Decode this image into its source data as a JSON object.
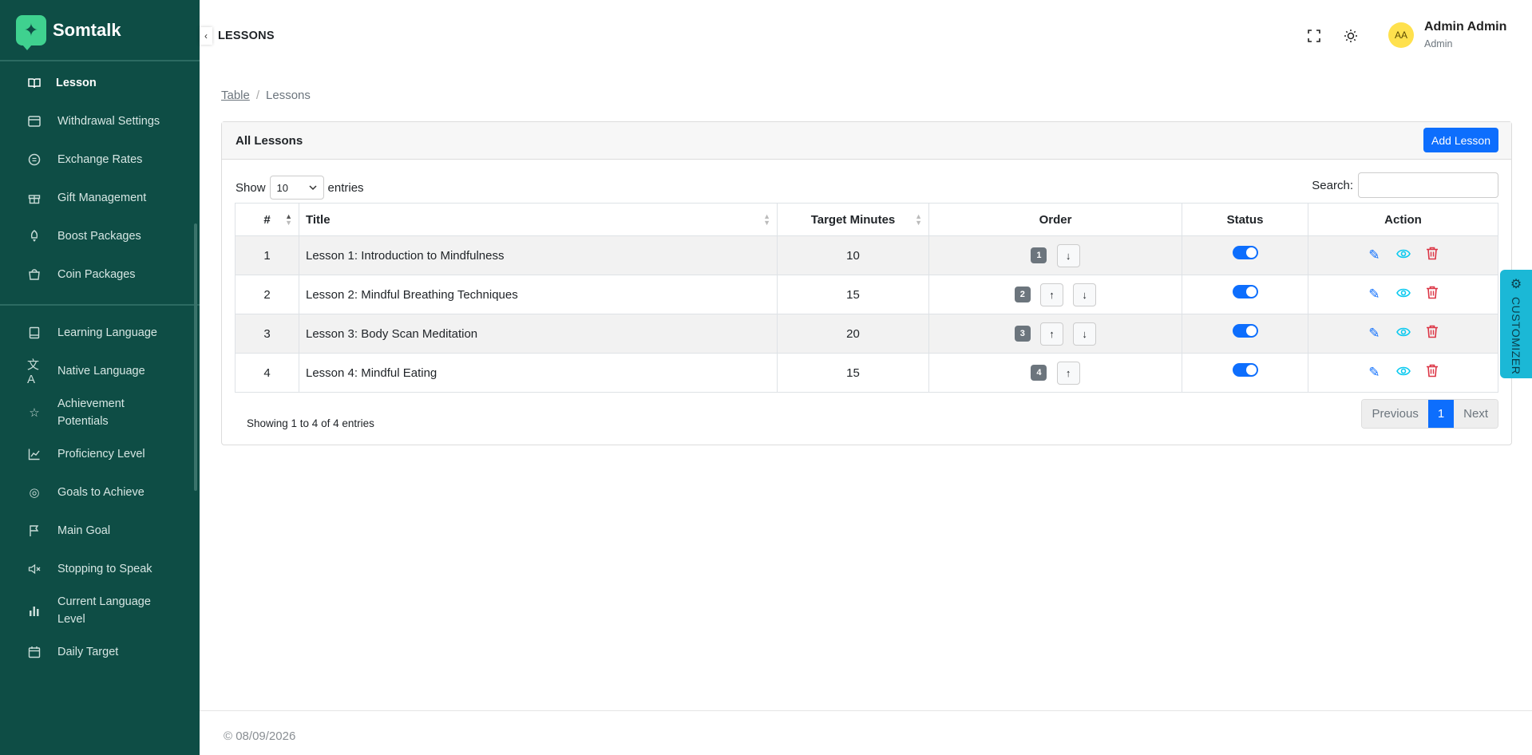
{
  "brand": {
    "name": "Somtalk",
    "logo_icon": "sparkle-icon",
    "sidebar_color": "#0e4d45"
  },
  "sidebar": {
    "group1": [
      {
        "label": "Lesson",
        "icon": "book-icon",
        "active": true
      },
      {
        "label": "Withdrawal Settings",
        "icon": "card-icon"
      },
      {
        "label": "Exchange Rates",
        "icon": "currency-icon"
      },
      {
        "label": "Gift Management",
        "icon": "gift-icon"
      },
      {
        "label": "Boost Packages",
        "icon": "rocket-icon"
      },
      {
        "label": "Coin Packages",
        "icon": "package-icon"
      }
    ],
    "group2": [
      {
        "label": "Learning Language",
        "icon": "notebook-icon"
      },
      {
        "label": "Native Language",
        "icon": "translate-icon"
      },
      {
        "label": "Achievement Potentials",
        "icon": "star-icon"
      },
      {
        "label": "Proficiency Level",
        "icon": "chart-line-icon"
      },
      {
        "label": "Goals to Achieve",
        "icon": "target-icon"
      },
      {
        "label": "Main Goal",
        "icon": "flag-icon"
      },
      {
        "label": "Stopping to Speak",
        "icon": "mute-icon"
      },
      {
        "label": "Current Language Level",
        "icon": "bar-chart-icon"
      },
      {
        "label": "Daily Target",
        "icon": "calendar-icon"
      }
    ]
  },
  "header": {
    "title": "LESSONS",
    "user": {
      "initials": "AA",
      "name": "Admin Admin",
      "role": "Admin"
    }
  },
  "breadcrumb": {
    "parent": "Table",
    "current": "Lessons"
  },
  "card": {
    "title": "All Lessons",
    "add_label": "Add Lesson",
    "show_label": "Show",
    "entries_value": "10",
    "entries_label": "entries",
    "search_label": "Search:"
  },
  "table": {
    "columns": [
      "#",
      "Title",
      "Target Minutes",
      "Order",
      "Status",
      "Action"
    ],
    "rows": [
      {
        "num": "1",
        "title": "Lesson 1: Introduction to Mindfulness",
        "minutes": "10",
        "order": "1",
        "status": true
      },
      {
        "num": "2",
        "title": "Lesson 2: Mindful Breathing Techniques",
        "minutes": "15",
        "order": "2",
        "status": true
      },
      {
        "num": "3",
        "title": "Lesson 3: Body Scan Meditation",
        "minutes": "20",
        "order": "3",
        "status": true
      },
      {
        "num": "4",
        "title": "Lesson 4: Mindful Eating",
        "minutes": "15",
        "order": "4",
        "status": true
      }
    ]
  },
  "pagination": {
    "info": "Showing 1 to 4 of 4 entries",
    "previous": "Previous",
    "current": "1",
    "next": "Next"
  },
  "customizer": {
    "label": "CUSTOMIZER"
  },
  "footer": {
    "text": "© 08/09/2026"
  }
}
